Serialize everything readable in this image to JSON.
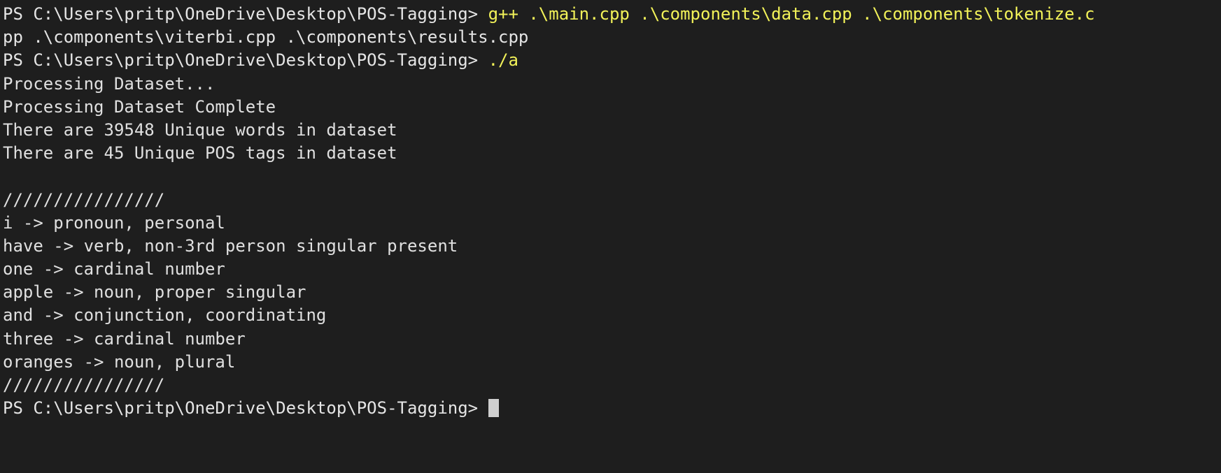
{
  "terminal": {
    "shell": "PowerShell",
    "background_color": "#1e1e1e",
    "text_color": "#e5e5e5",
    "command_color": "#f2f259",
    "cursor_color": "#cfcfcf",
    "prompt": "PS C:\\Users\\pritp\\OneDrive\\Desktop\\POS-Tagging>",
    "lines": [
      {
        "type": "prompt",
        "prompt": "PS C:\\Users\\pritp\\OneDrive\\Desktop\\POS-Tagging> ",
        "command": "g++ .\\main.cpp .\\components\\data.cpp .\\components\\tokenize.c"
      },
      {
        "type": "command-wrap",
        "command": "pp .\\components\\viterbi.cpp .\\components\\results.cpp"
      },
      {
        "type": "prompt",
        "prompt": "PS C:\\Users\\pritp\\OneDrive\\Desktop\\POS-Tagging> ",
        "command": "./a"
      },
      {
        "type": "output",
        "text": "Processing Dataset..."
      },
      {
        "type": "output",
        "text": "Processing Dataset Complete"
      },
      {
        "type": "output",
        "text": "There are 39548 Unique words in dataset"
      },
      {
        "type": "output",
        "text": "There are 45 Unique POS tags in dataset"
      },
      {
        "type": "blank",
        "text": ""
      },
      {
        "type": "separator",
        "text": "////////////////"
      },
      {
        "type": "output",
        "text": "i -> pronoun, personal"
      },
      {
        "type": "output",
        "text": "have -> verb, non-3rd person singular present"
      },
      {
        "type": "output",
        "text": "one -> cardinal number"
      },
      {
        "type": "output",
        "text": "apple -> noun, proper singular"
      },
      {
        "type": "output",
        "text": "and -> conjunction, coordinating"
      },
      {
        "type": "output",
        "text": "three -> cardinal number"
      },
      {
        "type": "output",
        "text": "oranges -> noun, plural"
      },
      {
        "type": "separator",
        "text": "////////////////"
      },
      {
        "type": "prompt-cursor",
        "prompt": "PS C:\\Users\\pritp\\OneDrive\\Desktop\\POS-Tagging> ",
        "command": ""
      }
    ],
    "stats": {
      "unique_words": "39548",
      "unique_pos_tags": "45"
    },
    "tagged_tokens": [
      {
        "word": "i",
        "tag": "pronoun, personal"
      },
      {
        "word": "have",
        "tag": "verb, non-3rd person singular present"
      },
      {
        "word": "one",
        "tag": "cardinal number"
      },
      {
        "word": "apple",
        "tag": "noun, proper singular"
      },
      {
        "word": "and",
        "tag": "conjunction, coordinating"
      },
      {
        "word": "three",
        "tag": "cardinal number"
      },
      {
        "word": "oranges",
        "tag": "noun, plural"
      }
    ]
  }
}
